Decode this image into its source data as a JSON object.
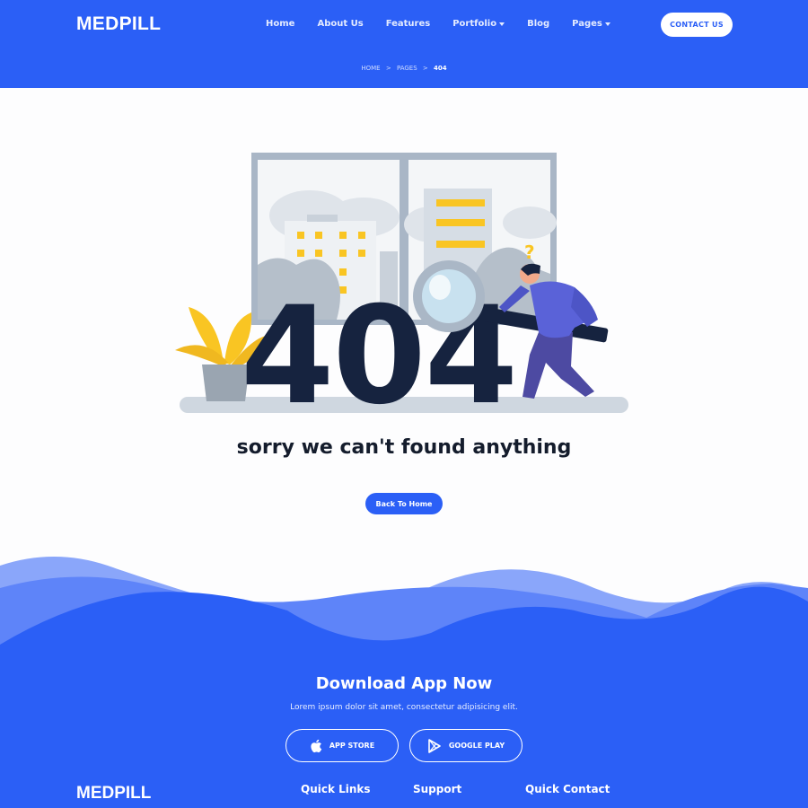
{
  "header": {
    "logo": "MEDPILL",
    "nav": [
      {
        "label": "Home"
      },
      {
        "label": "About Us"
      },
      {
        "label": "Features"
      },
      {
        "label": "Portfolio"
      },
      {
        "label": "Blog"
      },
      {
        "label": "Pages"
      }
    ],
    "contact_label": "CONTACT US",
    "breadcrumb": {
      "home": "HOME",
      "sep1": ">",
      "pages": "PAGES",
      "sep2": ">",
      "current": "404"
    }
  },
  "illustration": {
    "error_code": "404",
    "question_mark": "?"
  },
  "main": {
    "message": "sorry we can't found anything",
    "back_label": "Back To Home"
  },
  "footer": {
    "app_title": "Download App Now",
    "app_subtitle": "Lorem ipsum dolor sit amet, consectetur adipisicing elit.",
    "app_store_label": "APP STORE",
    "google_play_label": "GOOGLE PLAY",
    "logo": "MEDPILL",
    "columns": [
      "Quick Links",
      "Support",
      "Quick Contact"
    ]
  },
  "colors": {
    "brand": "#2b5ff6",
    "dark_text": "#141c2c",
    "accent_yellow": "#f9c523",
    "figure_purple": "#5a62d8"
  },
  "icons": [
    "apple-icon",
    "google-play-icon",
    "magnifier-icon",
    "plant-icon"
  ]
}
